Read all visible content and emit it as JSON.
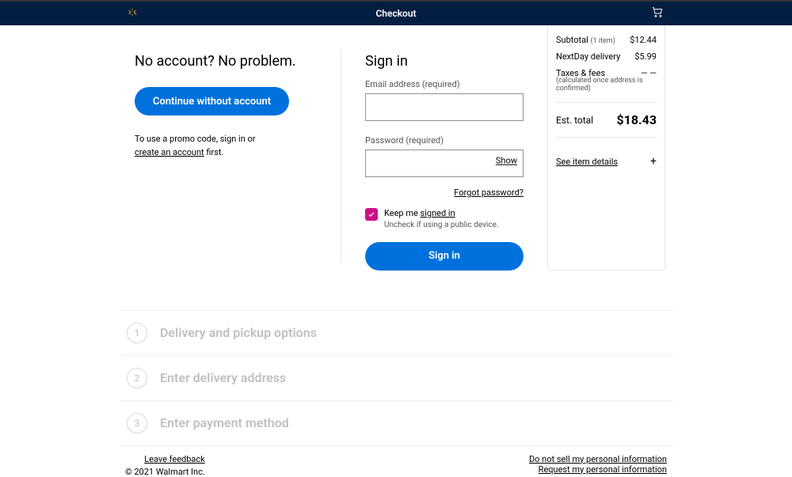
{
  "header": {
    "title": "Checkout"
  },
  "no_account": {
    "title": "No account? No problem.",
    "button": "Continue without account",
    "promo_prefix": "To use a promo code, sign in or",
    "promo_link": "create an account",
    "promo_suffix": " first."
  },
  "signin": {
    "title": "Sign in",
    "email_label": "Email address (required)",
    "password_label": "Password (required)",
    "show": "Show",
    "forgot": "Forgot password?",
    "keep_prefix": "Keep me ",
    "keep_link": "signed in",
    "keep_sub": "Uncheck if using a public device.",
    "button": "Sign in"
  },
  "summary": {
    "subtotal_label": "Subtotal",
    "subtotal_count": "(1 item)",
    "subtotal_value": "$12.44",
    "nextday_label": "NextDay delivery",
    "nextday_value": "$5.99",
    "taxes_label": "Taxes & fees",
    "taxes_value": "— —",
    "taxes_note": "(calculated once address is confirmed)",
    "est_label": "Est. total",
    "est_value": "$18.43",
    "see_details": "See item details"
  },
  "steps": [
    {
      "num": "1",
      "label": "Delivery and pickup options"
    },
    {
      "num": "2",
      "label": "Enter delivery address"
    },
    {
      "num": "3",
      "label": "Enter payment method"
    }
  ],
  "footer": {
    "leave_feedback": "Leave feedback",
    "copyright": "© 2021 Walmart Inc.",
    "do_not_sell": "Do not sell my personal information",
    "request_info": "Request my personal information"
  }
}
